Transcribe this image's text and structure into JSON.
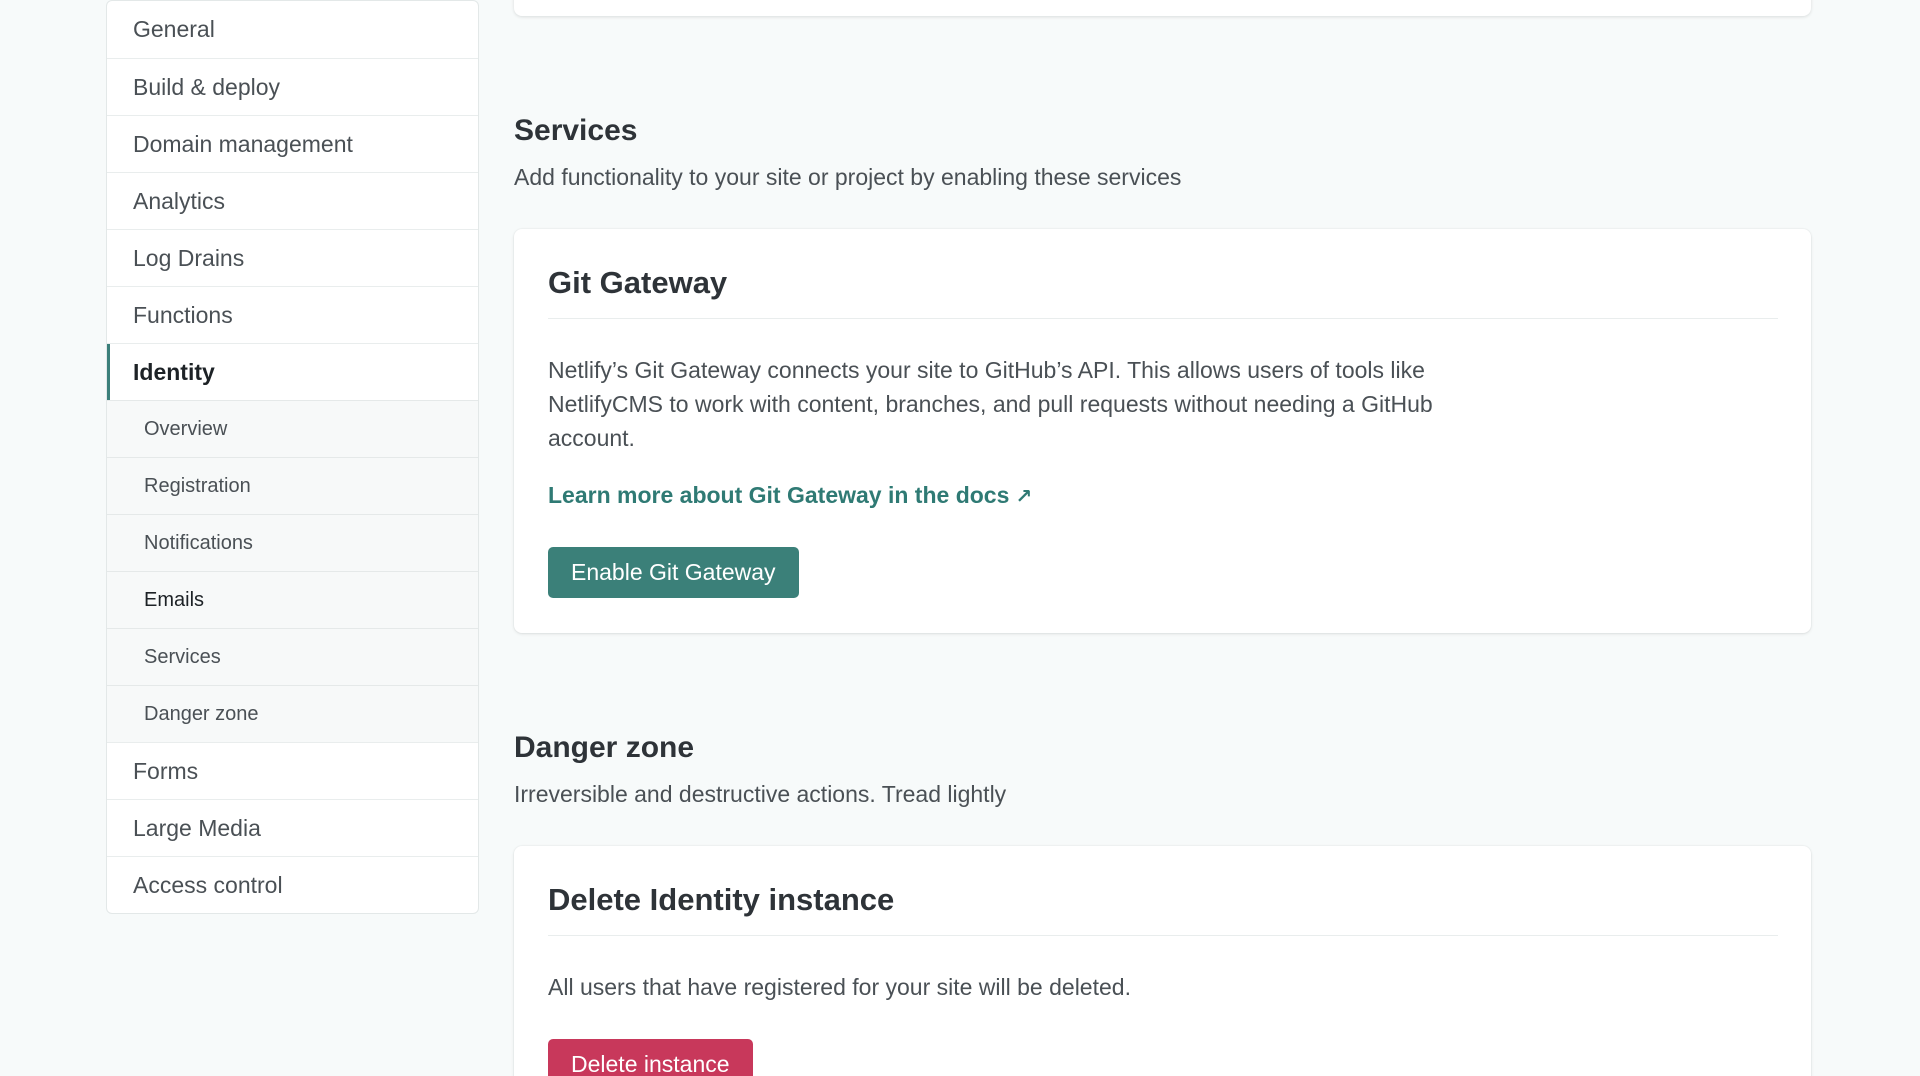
{
  "sidebar": {
    "items_top": [
      {
        "label": "General"
      },
      {
        "label": "Build & deploy"
      },
      {
        "label": "Domain management"
      },
      {
        "label": "Analytics"
      },
      {
        "label": "Log Drains"
      },
      {
        "label": "Functions"
      }
    ],
    "active_item": {
      "label": "Identity"
    },
    "sub_items": [
      {
        "label": "Overview"
      },
      {
        "label": "Registration"
      },
      {
        "label": "Notifications"
      },
      {
        "label": "Emails"
      },
      {
        "label": "Services"
      },
      {
        "label": "Danger zone"
      }
    ],
    "items_bottom": [
      {
        "label": "Forms"
      },
      {
        "label": "Large Media"
      },
      {
        "label": "Access control"
      }
    ]
  },
  "services": {
    "title": "Services",
    "description": "Add functionality to your site or project by enabling these services",
    "card": {
      "title": "Git Gateway",
      "body": "Netlify’s Git Gateway connects your site to GitHub’s API. This allows users of tools like NetlifyCMS to work with content, branches, and pull requests without needing a GitHub account.",
      "link_label": "Learn more about Git Gateway in the docs",
      "link_arrow": "↗",
      "button_label": "Enable Git Gateway"
    }
  },
  "danger_zone": {
    "title": "Danger zone",
    "description": "Irreversible and destructive actions. Tread lightly",
    "card": {
      "title": "Delete Identity instance",
      "body": "All users that have registered for your site will be deleted.",
      "button_label": "Delete instance"
    }
  },
  "colors": {
    "accent": "#3b8079",
    "danger": "#c8385b",
    "link": "#2f7a74"
  }
}
